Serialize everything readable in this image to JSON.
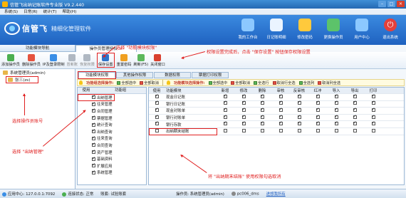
{
  "window": {
    "title": "信管飞出纳记账软件专业版 V9.2.440"
  },
  "menu": [
    "系统(S)",
    "日常(R)",
    "统计(T)",
    "帮助(H)"
  ],
  "header": {
    "brand": "信管飞",
    "slogan": "精细化管理软件",
    "buttons": [
      "我的工作台",
      "日记账明细",
      "修改密码",
      "更换操作员",
      "用户中心",
      "退出系统"
    ]
  },
  "left": {
    "tab": "功能模块导航",
    "users": [
      "系统管理员(admin)",
      "张三(zs)"
    ]
  },
  "tabs": [
    {
      "label": "操作员管理授权",
      "close": "×"
    }
  ],
  "toolbar": [
    "添加操作员",
    "删除操作员",
    "IP及登录限制",
    "冒新账",
    "恢复权限",
    "保存设置",
    "重置密码",
    "刷新(F5)",
    "关闭窗口"
  ],
  "subtabs": [
    "功能模块权限",
    "其他操作权限",
    "数据权限",
    "票据打印权限"
  ],
  "ops": {
    "func_label": "功能组选择操作:",
    "module_label": "功能模块选择操作:",
    "items_left": [
      "全部选中",
      "全部取消"
    ],
    "items_right": [
      "全部选中",
      "全部取消",
      "全选行",
      "取消行全选",
      "全选列",
      "取消列全选"
    ]
  },
  "tree": {
    "headers": [
      "使用",
      "功能组"
    ],
    "rows": [
      {
        "label": "出纳管理",
        "checked": true,
        "selected": true
      },
      {
        "label": "往来管理",
        "checked": true
      },
      {
        "label": "合同管理",
        "checked": true
      },
      {
        "label": "票据管理",
        "checked": true
      },
      {
        "label": "统计查询",
        "checked": true
      },
      {
        "label": "出纳查询",
        "checked": true
      },
      {
        "label": "往来查询",
        "checked": true
      },
      {
        "label": "合同查询",
        "checked": true
      },
      {
        "label": "资产管理",
        "checked": true
      },
      {
        "label": "基础资料",
        "checked": true
      },
      {
        "label": "扩展应用",
        "checked": true
      },
      {
        "label": "系统管理",
        "checked": true
      }
    ]
  },
  "grid": {
    "headers": [
      "使用",
      "功能模块",
      "新增",
      "修改",
      "删除",
      "审核",
      "反审核",
      "红冲",
      "导入",
      "导出",
      "打印"
    ],
    "rows": [
      {
        "label": "现金日记账",
        "use": true,
        "perms": [
          true,
          true,
          true,
          true,
          true,
          true,
          true,
          true,
          true
        ]
      },
      {
        "label": "银行日记账",
        "use": true,
        "perms": [
          true,
          true,
          true,
          true,
          true,
          true,
          true,
          true,
          true
        ]
      },
      {
        "label": "现金对账单",
        "use": true,
        "perms": [
          true,
          true,
          true,
          true,
          true,
          true,
          true,
          true,
          true
        ]
      },
      {
        "label": "银行对账单",
        "use": true,
        "perms": [
          true,
          true,
          true,
          true,
          true,
          true,
          true,
          true,
          true
        ]
      },
      {
        "label": "银行存款",
        "use": true,
        "perms": [
          true,
          true,
          true,
          true,
          true,
          true,
          true,
          true,
          true
        ]
      },
      {
        "label": "出纳期末结账",
        "use": false,
        "perms": [
          false,
          false,
          false,
          false,
          false,
          false,
          false,
          false,
          false
        ]
      }
    ]
  },
  "annotations": {
    "a1": "选择 \"功能模块权限\"",
    "a2": "权限设置完成后，点击 \"保存设置\" 按钮保存权限设置",
    "a3": "选择操作员账号",
    "a4": "选择 \"出纳管理\"",
    "a5": "将 \"出纳期末结账\" 使用权限勾选取消"
  },
  "status": {
    "server": "应用中心: 127.0.0.1:7092",
    "conn": "连接状态: 正常",
    "account": "账套: 试验账套",
    "operator": "操作员: 系统管理员(admin)",
    "machine": "pc006_dms",
    "link": "进想我所有"
  },
  "colors": {
    "accent": "#1f62c0",
    "annotation": "#e02020"
  }
}
